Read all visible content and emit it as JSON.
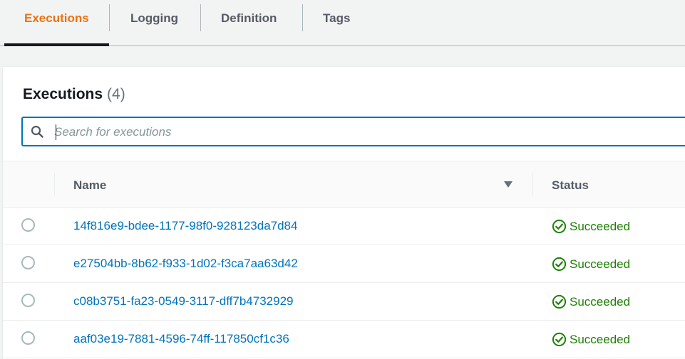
{
  "tabs": [
    {
      "label": "Executions",
      "active": true
    },
    {
      "label": "Logging",
      "active": false
    },
    {
      "label": "Definition",
      "active": false
    },
    {
      "label": "Tags",
      "active": false
    }
  ],
  "panel": {
    "title": "Executions",
    "count": "(4)"
  },
  "search": {
    "placeholder": "Search for executions",
    "value": ""
  },
  "table": {
    "columns": {
      "name": "Name",
      "status": "Status"
    },
    "rows": [
      {
        "name": "14f816e9-bdee-1177-98f0-928123da7d84",
        "status": "Succeeded"
      },
      {
        "name": "e27504bb-8b62-f933-1d02-f3ca7aa63d42",
        "status": "Succeeded"
      },
      {
        "name": "c08b3751-fa23-0549-3117-dff7b4732929",
        "status": "Succeeded"
      },
      {
        "name": "aaf03e19-7881-4596-74ff-117850cf1c36",
        "status": "Succeeded"
      }
    ]
  },
  "colors": {
    "accent": "#ec7211",
    "link": "#0073bb",
    "success": "#1d8102"
  },
  "icons": {
    "search": "search-icon",
    "status": "check-circle-icon",
    "sort": "caret-down-icon"
  }
}
